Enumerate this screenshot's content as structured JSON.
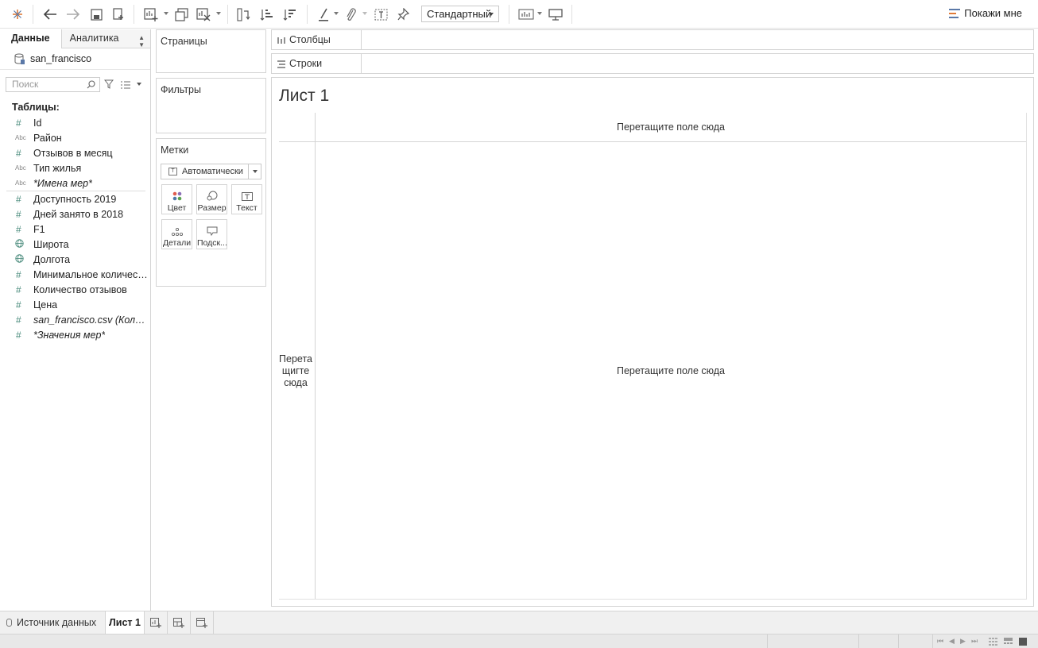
{
  "toolbar": {
    "fit_select": "Стандартный",
    "show_me": "Покажи мне",
    "icons": [
      "tableau-logo-icon",
      "undo-icon",
      "redo-icon",
      "save-icon",
      "new-datasource-icon",
      "new-worksheet-icon",
      "duplicate-sheet-icon",
      "clear-sheet-icon",
      "swap-rows-columns-icon",
      "sort-ascending-icon",
      "sort-descending-icon",
      "highlight-icon",
      "group-icon",
      "labels-icon",
      "pin-icon",
      "fit-width-icon",
      "presentation-icon"
    ]
  },
  "data_pane": {
    "tabs": [
      "Данные",
      "Аналитика"
    ],
    "datasource": "san_francisco",
    "search_placeholder": "Поиск",
    "tables_heading": "Таблицы:",
    "dimensions": [
      {
        "icon": "#",
        "icon_name": "number-icon",
        "label": "Id"
      },
      {
        "icon": "Abc",
        "icon_name": "string-icon",
        "label": "Район"
      },
      {
        "icon": "#",
        "icon_name": "number-icon",
        "label": "Отзывов в месяц"
      },
      {
        "icon": "Abc",
        "icon_name": "string-icon",
        "label": "Тип жилья"
      },
      {
        "icon": "Abc",
        "icon_name": "string-icon",
        "label": "*Имена мер*"
      }
    ],
    "measures": [
      {
        "icon": "#",
        "icon_name": "number-icon",
        "label": "Доступность 2019"
      },
      {
        "icon": "#",
        "icon_name": "number-icon",
        "label": "Дней занято в 2018"
      },
      {
        "icon": "#",
        "icon_name": "number-icon",
        "label": "F1"
      },
      {
        "icon": "globe",
        "icon_name": "geo-icon",
        "label": "Широта"
      },
      {
        "icon": "globe",
        "icon_name": "geo-icon",
        "label": "Долгота"
      },
      {
        "icon": "#",
        "icon_name": "number-icon",
        "label": "Минимальное количество"
      },
      {
        "icon": "#",
        "icon_name": "number-icon",
        "label": "Количество отзывов"
      },
      {
        "icon": "#",
        "icon_name": "number-icon",
        "label": "Цена"
      },
      {
        "icon": "#",
        "icon_name": "number-icon",
        "label": "san_francisco.csv (Количе..."
      },
      {
        "icon": "#",
        "icon_name": "number-icon",
        "label": "*Значения мер*"
      }
    ]
  },
  "cards": {
    "pages": "Страницы",
    "filters": "Фильтры",
    "marks": "Метки",
    "marks_type": "Автоматически",
    "mark_buttons": [
      {
        "label": "Цвет",
        "icon": "color-icon"
      },
      {
        "label": "Размер",
        "icon": "size-icon"
      },
      {
        "label": "Текст",
        "icon": "text-icon"
      },
      {
        "label": "Детали",
        "icon": "detail-icon"
      },
      {
        "label": "Подск...",
        "icon": "tooltip-icon"
      }
    ]
  },
  "shelves": {
    "columns": "Столбцы",
    "rows": "Строки"
  },
  "view": {
    "title": "Лист 1",
    "drop_columns": "Перетащите поле сюда",
    "drop_main": "Перетащите поле сюда",
    "drop_rows_line1": "Перета",
    "drop_rows_line2": "щигте",
    "drop_rows_line3": "сюда"
  },
  "tabs": {
    "datasource": "Источник данных",
    "sheet1": "Лист 1"
  },
  "colors": {
    "accent_number": "#4a8b7c",
    "border": "#d4d4d4",
    "tab_bar": "#f0f0f0"
  }
}
